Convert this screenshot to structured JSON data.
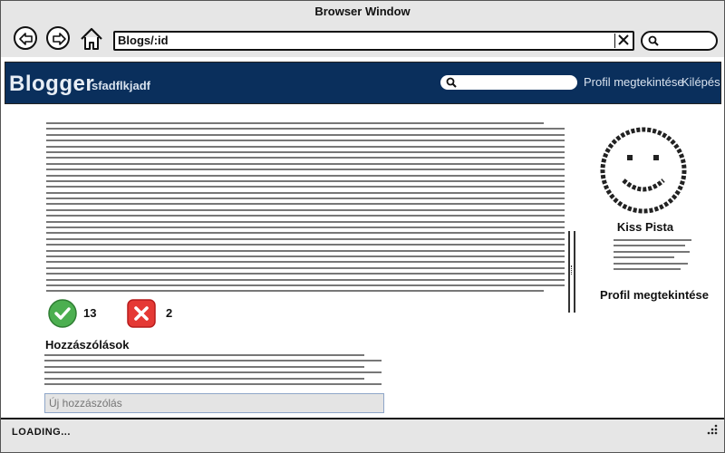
{
  "window": {
    "title": "Browser Window"
  },
  "toolbar": {
    "url": "Blogs/:id"
  },
  "header": {
    "brand": "Blogger",
    "blog_name": "sfadflkjadf",
    "view_profile": "Profil megtekintése",
    "logout": "Kilépés"
  },
  "post": {
    "line_count": 30
  },
  "votes": {
    "up_count": "13",
    "down_count": "2",
    "up_color": "#4caf50",
    "down_color": "#e53935"
  },
  "comments": {
    "title": "Hozzászólások",
    "placeholder": "Új hozzászólás",
    "line_count": 6
  },
  "profile": {
    "name": "Kiss Pista",
    "view_profile": "Profil megtekintése",
    "line_count": 6
  },
  "status": {
    "text": "LOADING..."
  },
  "icons": {
    "back": "back-arrow-icon",
    "forward": "forward-arrow-icon",
    "home": "home-icon",
    "clear": "close-icon",
    "search": "search-icon",
    "upvote": "check-icon",
    "downvote": "x-icon",
    "avatar": "smiley-face-icon",
    "resize": "resize-grip-icon"
  }
}
